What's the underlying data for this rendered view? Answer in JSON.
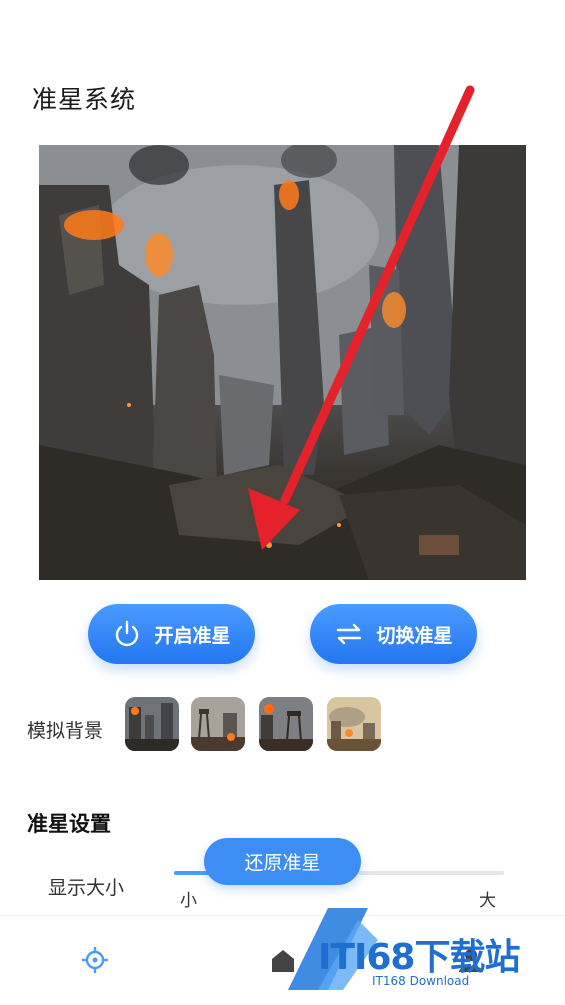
{
  "page": {
    "title": "准星系统"
  },
  "buttons": {
    "enable_label": "开启准星",
    "switch_label": "切换准星",
    "restore_label": "还原准星"
  },
  "background": {
    "label": "模拟背景",
    "thumbnail_count": 4
  },
  "settings": {
    "section_title": "准星设置",
    "size_label": "显示大小",
    "size_min_label": "小",
    "size_max_label": "大",
    "size_level": 0.12
  },
  "tabbar": {
    "items": [
      "crosshair-icon",
      "home-icon",
      "user-icon"
    ]
  },
  "watermark": {
    "text": "ITI68下载站",
    "subtext": "IT168 Download"
  },
  "colors": {
    "accent": "#2f86f6",
    "arrow": "#e5212a",
    "watermark": "#1f6fd1"
  }
}
